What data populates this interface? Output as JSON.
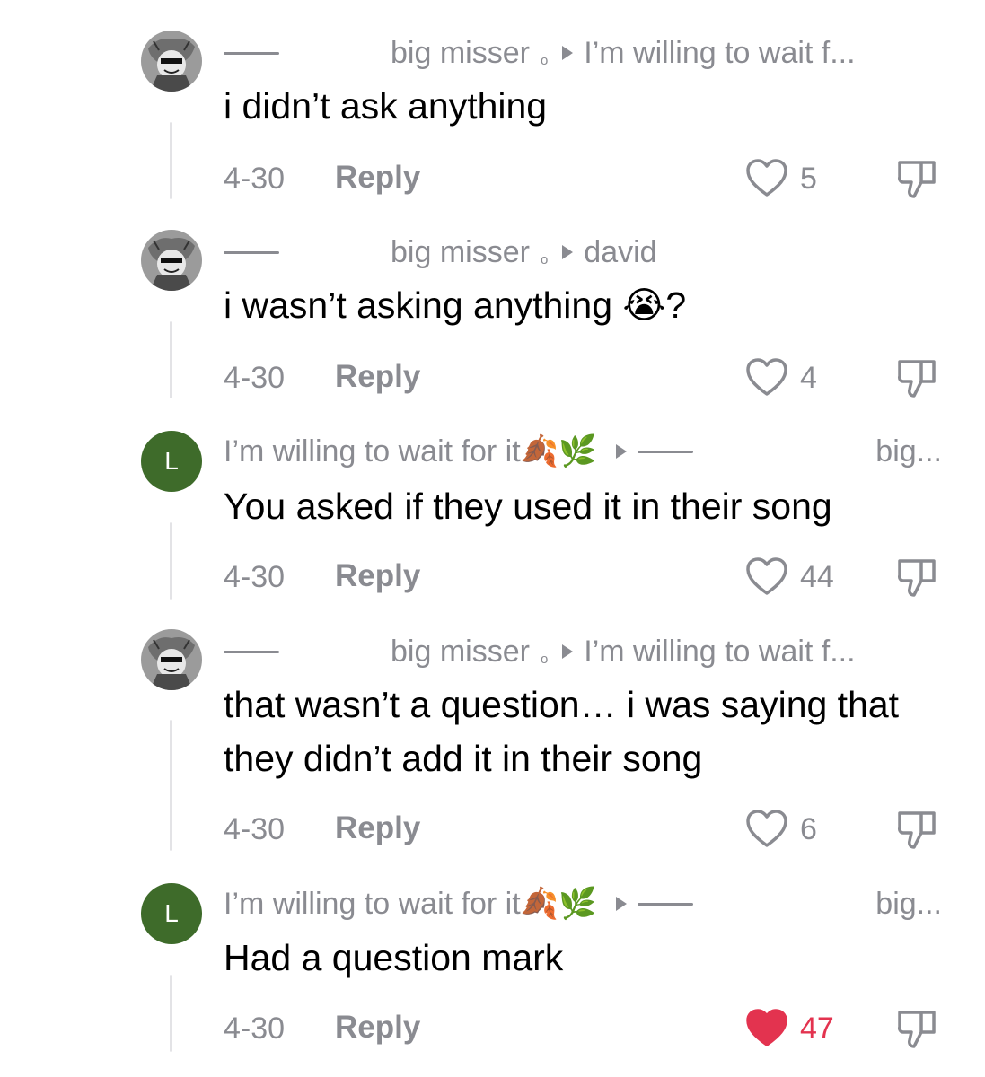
{
  "comments": [
    {
      "avatar": "sketch-avatar",
      "author": "big misser",
      "reply_to": "I’m willing to wait f...",
      "text": "i didn’t ask anything",
      "date": "4-30",
      "reply_label": "Reply",
      "likes": "5",
      "liked": false
    },
    {
      "avatar": "sketch-avatar",
      "author": "big misser",
      "reply_to": "david",
      "text": "i wasn’t asking anything 😭?",
      "date": "4-30",
      "reply_label": "Reply",
      "likes": "4",
      "liked": false
    },
    {
      "avatar_letter": "L",
      "author": "I’m willing to wait for it🍂🌿",
      "reply_to": "big...",
      "text": "You asked if they used it in their song",
      "date": "4-30",
      "reply_label": "Reply",
      "likes": "44",
      "liked": false
    },
    {
      "avatar": "sketch-avatar",
      "author": "big misser",
      "reply_to": "I’m willing to wait f...",
      "text": "that wasn’t a question… i was saying that they didn’t add it in their song",
      "date": "4-30",
      "reply_label": "Reply",
      "likes": "6",
      "liked": false
    },
    {
      "avatar_letter": "L",
      "author": "I’m willing to wait for it🍂🌿",
      "reply_to": "big...",
      "text": "Had a question mark",
      "date": "4-30",
      "reply_label": "Reply",
      "likes": "47",
      "liked": true
    }
  ],
  "colors": {
    "meta_gray": "#8a8b91",
    "like_red": "#e3334f",
    "letter_avatar_bg": "#3e6b2a"
  },
  "icons": {
    "like": "heart-icon",
    "dislike": "thumbs-down-icon",
    "reply_arrow": "triangle-right-icon"
  }
}
